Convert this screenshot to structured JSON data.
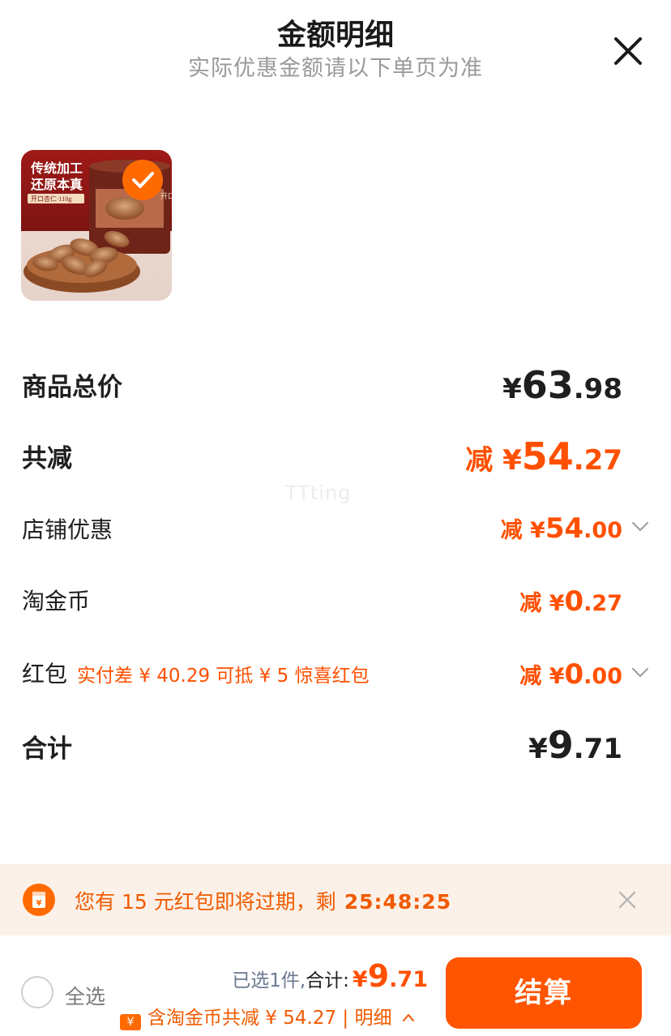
{
  "header": {
    "title": "金额明细",
    "subtitle": "实际优惠金额请以下单页为准"
  },
  "product": {
    "thumb_text_1": "传统加工",
    "thumb_text_2": "还原本真",
    "thumb_tag": "开口杏仁·110g",
    "thumb_can_text": "开口杏仁"
  },
  "rows": {
    "total_price": {
      "label": "商品总价",
      "yen": "¥",
      "int": "63",
      "dec": ".98"
    },
    "total_discount": {
      "label": "共减",
      "prefix": "减 ¥",
      "int": "54",
      "dec": ".27"
    },
    "shop_discount": {
      "label": "店铺优惠",
      "prefix": "减 ¥",
      "int": "54",
      "dec": ".00"
    },
    "taojinbi": {
      "label": "淘金币",
      "prefix": "减 ¥",
      "int": "0",
      "dec": ".27"
    },
    "hongbao": {
      "label": "红包",
      "hint": "实付差 ¥ 40.29 可抵 ¥ 5 惊喜红包",
      "prefix": "减 ¥",
      "int": "0",
      "dec": ".00"
    },
    "subtotal": {
      "label": "合计",
      "yen": "¥",
      "int": "9",
      "dec": ".71"
    }
  },
  "watermark": "TTting",
  "banner": {
    "text": "您有 15 元红包即将过期，剩",
    "timer": "25:48:25"
  },
  "bottom": {
    "select_all": "全选",
    "selected_label": "已选1件,",
    "total_label": "合计:",
    "total_yen": "¥",
    "total_int": "9",
    "total_dec": ".71",
    "coin_summary": "含淘金币共减 ¥ 54.27 | 明细",
    "checkout": "结算"
  },
  "colors": {
    "accent": "#ff5000",
    "button": "#ff5500",
    "banner_bg": "#fcf1e8"
  }
}
